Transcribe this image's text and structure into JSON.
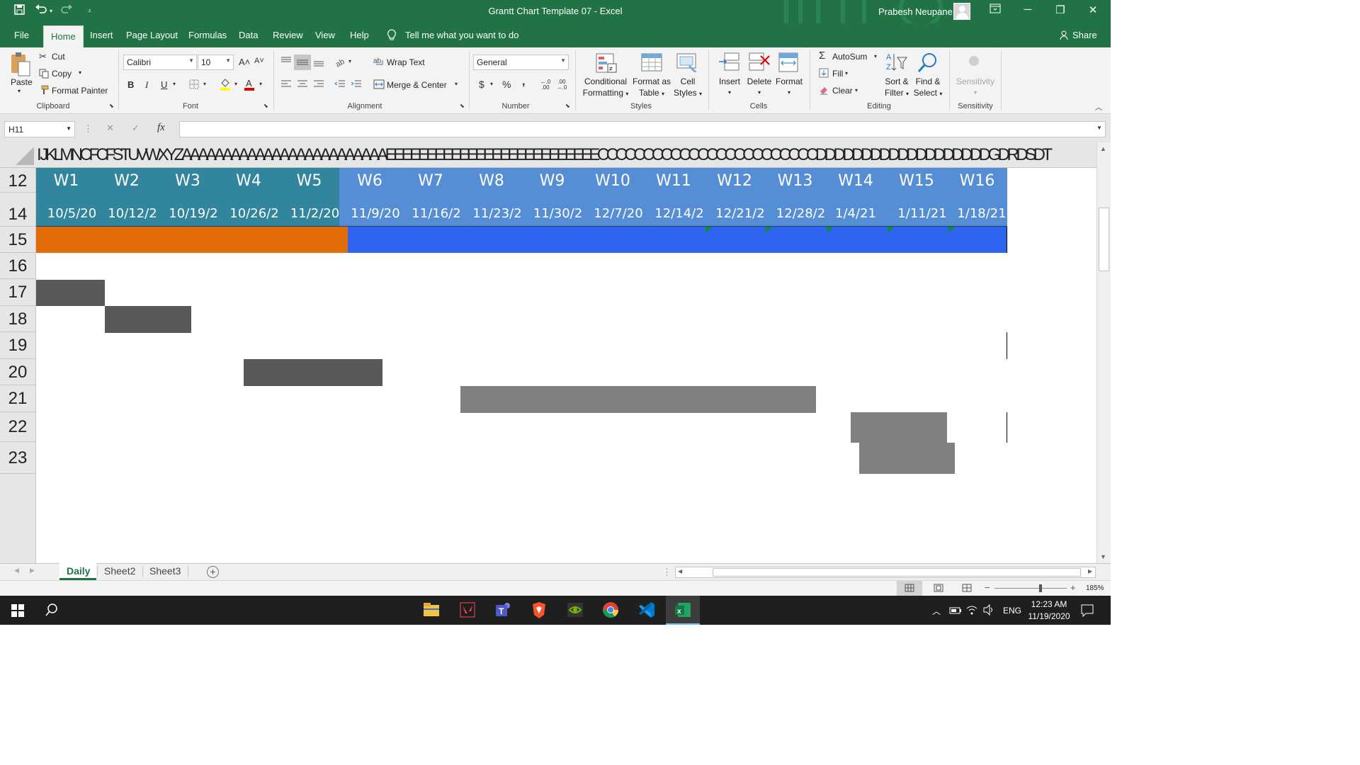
{
  "window": {
    "title": "Grantt Chart Template 07  -  Excel",
    "user": "Prabesh Neupane",
    "share_label": "Share",
    "minimize": "─",
    "restore": "❐",
    "close": "✕"
  },
  "tabs": [
    {
      "label": "File"
    },
    {
      "label": "Home"
    },
    {
      "label": "Insert"
    },
    {
      "label": "Page Layout"
    },
    {
      "label": "Formulas"
    },
    {
      "label": "Data"
    },
    {
      "label": "Review"
    },
    {
      "label": "View"
    },
    {
      "label": "Help"
    }
  ],
  "tell_me": "Tell me what you want to do",
  "ribbon": {
    "clipboard": {
      "paste": "Paste",
      "cut": "Cut",
      "copy": "Copy",
      "format_painter": "Format Painter",
      "group": "Clipboard"
    },
    "font": {
      "name": "Calibri",
      "size": "10",
      "group": "Font",
      "grow": "A˄",
      "shrink": "A˅",
      "bold": "B",
      "italic": "I",
      "underline": "U"
    },
    "alignment": {
      "wrap": "Wrap Text",
      "merge": "Merge & Center",
      "group": "Alignment"
    },
    "number": {
      "format": "General",
      "group": "Number",
      "currency": "$",
      "percent": "%",
      "comma": ",",
      "inc_decimal": "←.0 .00",
      "dec_decimal": ".00 →.0"
    },
    "styles": {
      "conditional_1": "Conditional",
      "conditional_2": "Formatting",
      "format_table_1": "Format as",
      "format_table_2": "Table",
      "cell_styles_1": "Cell",
      "cell_styles_2": "Styles",
      "group": "Styles"
    },
    "cells": {
      "insert": "Insert",
      "delete": "Delete",
      "format": "Format",
      "group": "Cells"
    },
    "editing": {
      "autosum": "AutoSum",
      "fill": "Fill",
      "clear": "Clear",
      "sort_1": "Sort &",
      "sort_2": "Filter",
      "find_1": "Find &",
      "find_2": "Select",
      "group": "Editing"
    },
    "sensitivity": {
      "label": "Sensitivity",
      "group": "Sensitivity"
    }
  },
  "formula_bar": {
    "name_box": "H11",
    "fx": "fx",
    "cancel": "✕",
    "enter": "✓",
    "value": ""
  },
  "column_header_text": "I JKLMNCFCFSTUVWXYZAAAAAAAAAAAAAAAAAAAAAAAAAEEEEEEEEEEEEEEEEEEEEEEEEEECCCCCCCCCCCCCCCCCCCCCCCCDDDDDDDDDDDDDDDDDDDGDRDSDT",
  "rows": [
    "12",
    "14",
    "15",
    "16",
    "17",
    "18",
    "19",
    "20",
    "21",
    "22",
    "23"
  ],
  "weeks": [
    "W1",
    "W2",
    "W3",
    "W4",
    "W5",
    "W6",
    "W7",
    "W8",
    "W9",
    "W10",
    "W11",
    "W12",
    "W13",
    "W14",
    "W15",
    "W16"
  ],
  "dates": [
    "10/5/20",
    "10/12/2",
    "10/19/2",
    "10/26/2",
    "11/2/20",
    "11/9/20",
    "11/16/2",
    "11/23/2",
    "11/30/2",
    "12/7/20",
    "12/14/2",
    "12/21/2",
    "12/28/2",
    "1/4/21",
    "1/11/21",
    "1/18/21"
  ],
  "colors": {
    "ribbon_green": "#217346",
    "header_teal": "#31859c",
    "header_blue": "#558ed5",
    "phase1_orange": "#e36c09",
    "phase2_blue": "#2f64f0",
    "task_dark": "#595959",
    "task_gray": "#808080"
  },
  "sheets": [
    {
      "label": "Daily",
      "active": true
    },
    {
      "label": "Sheet2",
      "active": false
    },
    {
      "label": "Sheet3",
      "active": false
    }
  ],
  "add_sheet": "+",
  "status": {
    "zoom": "185%",
    "zoom_minus": "−",
    "zoom_plus": "+"
  },
  "taskbar": {
    "time": "12:23 AM",
    "date": "11/19/2020",
    "lang": "ENG"
  }
}
